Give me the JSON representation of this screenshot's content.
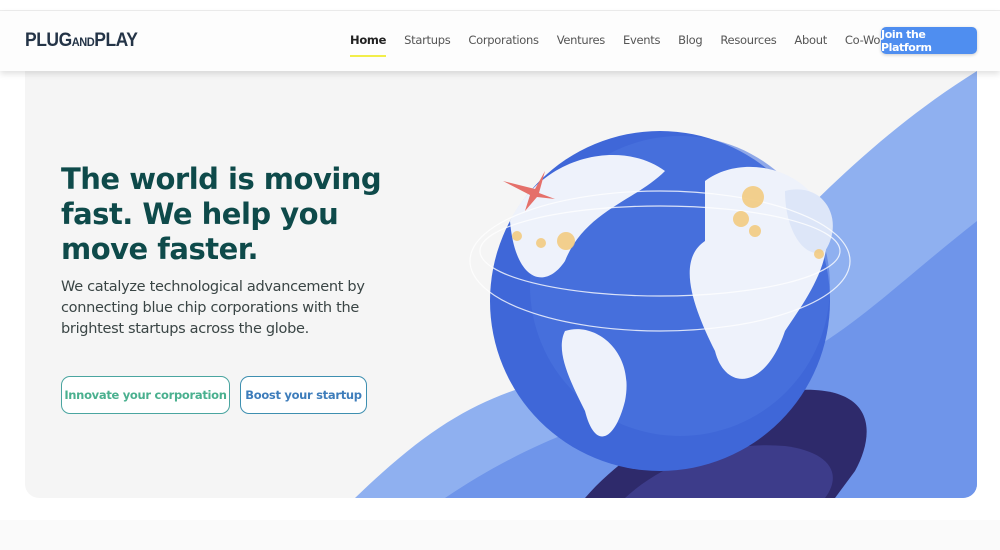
{
  "header": {
    "logo": {
      "main": "PLUG",
      "mid": "AND",
      "end": "PLAY"
    },
    "nav": [
      {
        "label": "Home",
        "active": true
      },
      {
        "label": "Startups"
      },
      {
        "label": "Corporations"
      },
      {
        "label": "Ventures"
      },
      {
        "label": "Events"
      },
      {
        "label": "Blog"
      },
      {
        "label": "Resources"
      },
      {
        "label": "About"
      },
      {
        "label": "Co-Working"
      }
    ],
    "cta": "Join the Platform"
  },
  "hero": {
    "title": "The world is moving fast. We help you move faster.",
    "subtitle": "We catalyze technological advancement by connecting blue chip corporations with the brightest startups across the globe.",
    "primary_button": "Innovate your corporation",
    "secondary_button": "Boost your startup"
  },
  "colors": {
    "accent": "#4f8ef0",
    "heading": "#0e4a4a",
    "nav_underline": "#f2ee4a",
    "globe": "#3f67d8"
  }
}
